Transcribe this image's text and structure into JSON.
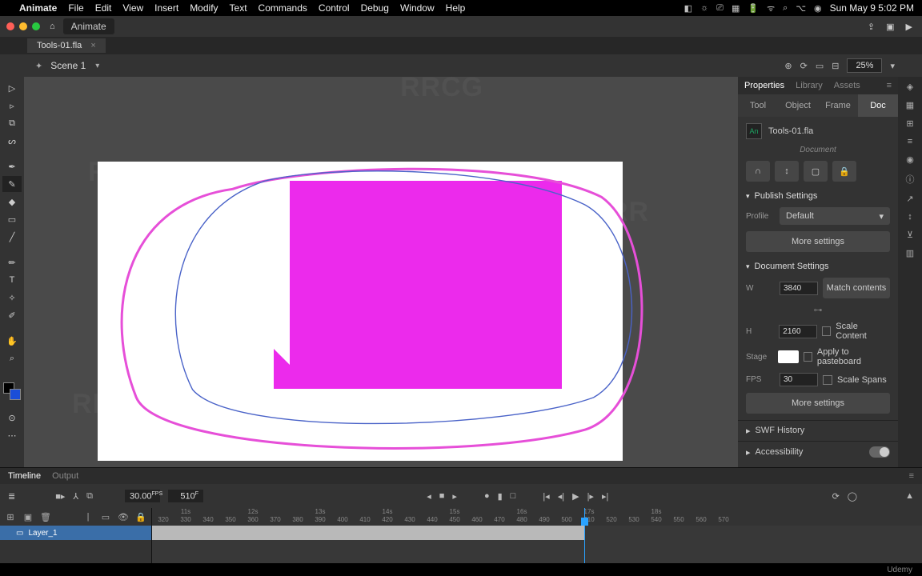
{
  "mac": {
    "app": "Animate",
    "menus": [
      "File",
      "Edit",
      "View",
      "Insert",
      "Modify",
      "Text",
      "Commands",
      "Control",
      "Debug",
      "Window",
      "Help"
    ],
    "clock": "Sun May 9  5:02 PM"
  },
  "app_tab": "Animate",
  "doc_tab": "Tools-01.fla",
  "scene": {
    "label": "Scene 1",
    "zoom": "25%"
  },
  "side_tabs": [
    "Properties",
    "Library",
    "Assets"
  ],
  "prop_tabs": [
    "Tool",
    "Object",
    "Frame",
    "Doc"
  ],
  "doc": {
    "filename": "Tools-01.fla",
    "subtitle": "Document",
    "publish_h": "Publish Settings",
    "profile_lbl": "Profile",
    "profile_val": "Default",
    "more_settings": "More settings",
    "docset_h": "Document Settings",
    "w_lbl": "W",
    "w_val": "3840",
    "h_lbl": "H",
    "h_val": "2160",
    "match": "Match contents",
    "stage_lbl": "Stage",
    "fps_lbl": "FPS",
    "fps_val": "30",
    "scale_content": "Scale Content",
    "apply_paste": "Apply to pasteboard",
    "scale_spans": "Scale Spans",
    "swf_h": "SWF History",
    "acc_h": "Accessibility"
  },
  "timeline": {
    "tabs": [
      "Timeline",
      "Output"
    ],
    "fps_display": "30.00",
    "frame_display": "510",
    "layer": "Layer_1",
    "ruler_top": [
      "11s",
      "12s",
      "13s",
      "14s",
      "15s",
      "16s",
      "17s",
      "18s"
    ],
    "ruler_bot": [
      "320",
      "330",
      "340",
      "350",
      "360",
      "370",
      "380",
      "390",
      "400",
      "410",
      "420",
      "430",
      "440",
      "450",
      "460",
      "470",
      "480",
      "490",
      "500",
      "510",
      "520",
      "530",
      "540",
      "550",
      "560",
      "570"
    ]
  },
  "footer": "Udemy"
}
